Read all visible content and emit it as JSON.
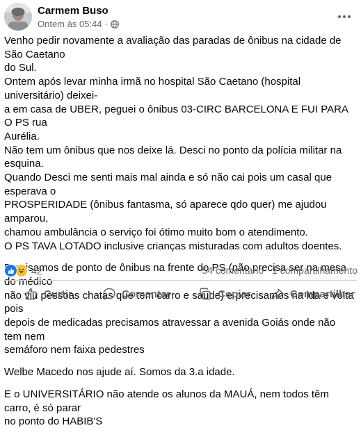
{
  "post": {
    "author": "Carmem Buso",
    "time": "Ontem às 05:44",
    "time_separator": "·",
    "paragraphs": [
      {
        "lines": [
          "Venho pedir novamente a avaliação das paradas de ônibus na cidade de São Caetano",
          "do Sul.",
          "Ontem após levar minha irmã no hospital São Caetano (hospital universitário) deixei-",
          "a em casa de UBER,  peguei o ônibus 03-CIRC BARCELONA E FUI PARA O PS rua",
          "Aurélia.",
          "Não tem um ônibus que nos deixe lá.  Desci no ponto da polícia militar na esquina.",
          "Quando Desci me senti mais mal ainda e só não cai pois um casal que esperava o",
          "PROSPERIDADE (ônibus fantasma, só aparece qdo quer) me ajudou amparou,",
          "chamou ambulância o serviço foi ótimo muito bom o atendimento.",
          "O PS TAVA LOTADO inclusive crianças misturadas com adultos doentes."
        ]
      },
      {
        "lines": [
          "Precisamos de ponto de ônibus na frente do PS (não precisa ser na mesa do médico",
          "não viu pessoas chatas que tem carro e saude) e precisamos na ida e volta pois",
          "depois de medicadas precisamos atravessar a avenida Goiás onde não tem nem",
          "semáforo nem faixa pedestres"
        ]
      },
      {
        "lines": [
          "Welbe Macedo nos ajude aí. Somos da 3.a idade."
        ]
      },
      {
        "lines": [
          "E o UNIVERSITÁRIO não atende os alunos da MAUÁ, nem todos têm carro, é só parar",
          "no ponto do HABIB'S"
        ]
      }
    ]
  },
  "stats": {
    "reactions_count": "42",
    "reaction_icons": [
      "like-icon",
      "haha-icon"
    ],
    "comments": "54 comentário",
    "shares": "1 compartilhamento"
  },
  "actions": {
    "like": "Curtir",
    "comment": "Comentar",
    "copy": "Copiar",
    "share": "Compartilhar"
  },
  "colors": {
    "like_blue": "#1877f2",
    "haha_yellow": "#f7c135",
    "secondary_text": "#65676b"
  }
}
